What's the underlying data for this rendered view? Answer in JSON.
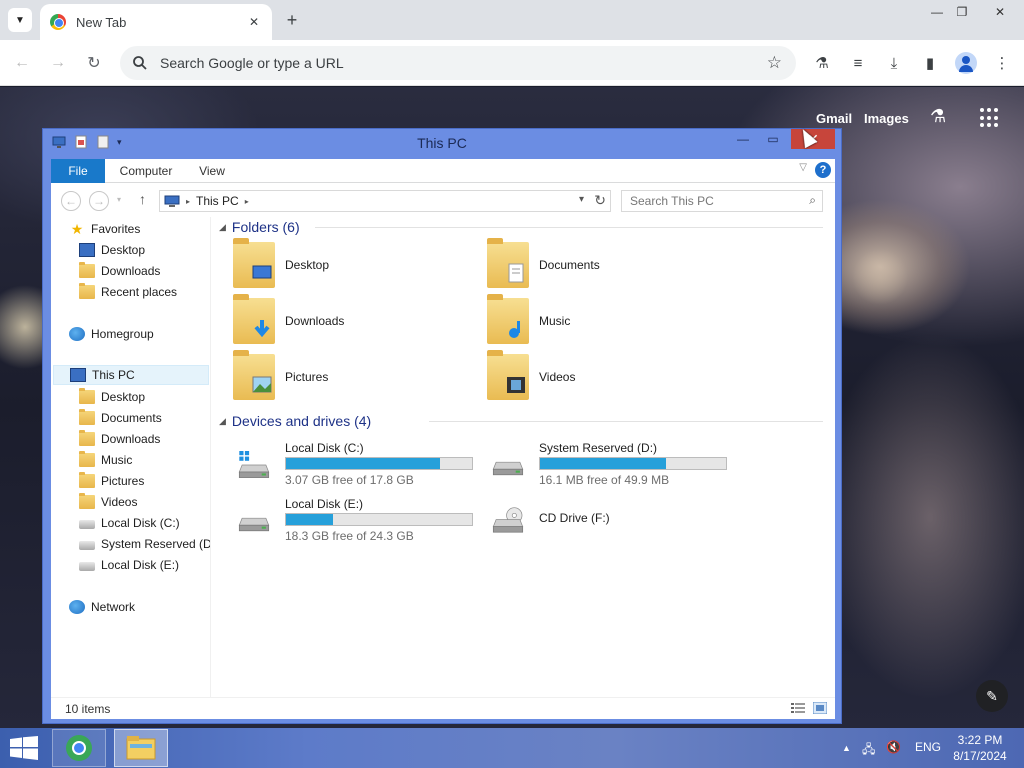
{
  "browser": {
    "tab_title": "New Tab",
    "omnibox_placeholder": "Search Google or type a URL",
    "ntp_links": [
      "Gmail",
      "Images"
    ]
  },
  "explorer": {
    "title": "This PC",
    "ribbon_tabs": [
      "File",
      "Computer",
      "View"
    ],
    "breadcrumb": [
      "This PC"
    ],
    "search_placeholder": "Search This PC",
    "nav": {
      "favorites": "Favorites",
      "favorites_items": [
        "Desktop",
        "Downloads",
        "Recent places"
      ],
      "homegroup": "Homegroup",
      "this_pc": "This PC",
      "this_pc_items": [
        "Desktop",
        "Documents",
        "Downloads",
        "Music",
        "Pictures",
        "Videos",
        "Local Disk (C:)",
        "System Reserved (D:)",
        "Local Disk (E:)"
      ],
      "network": "Network"
    },
    "folders_header": "Folders (6)",
    "folders": [
      "Desktop",
      "Documents",
      "Downloads",
      "Music",
      "Pictures",
      "Videos"
    ],
    "devices_header": "Devices and drives (4)",
    "drives": [
      {
        "name": "Local Disk (C:)",
        "free": "3.07 GB free of 17.8 GB",
        "used_pct": 83
      },
      {
        "name": "System Reserved (D:)",
        "free": "16.1 MB free of 49.9 MB",
        "used_pct": 68
      },
      {
        "name": "Local Disk (E:)",
        "free": "18.3 GB free of 24.3 GB",
        "used_pct": 25
      },
      {
        "name": "CD Drive (F:)",
        "free": "",
        "used_pct": null
      }
    ],
    "status": "10 items"
  },
  "taskbar": {
    "lang": "ENG",
    "time": "3:22 PM",
    "date": "8/17/2024"
  },
  "colors": {
    "accent": "#1979ca",
    "drive_bar": "#26a0da",
    "group_header": "#1e3287"
  }
}
